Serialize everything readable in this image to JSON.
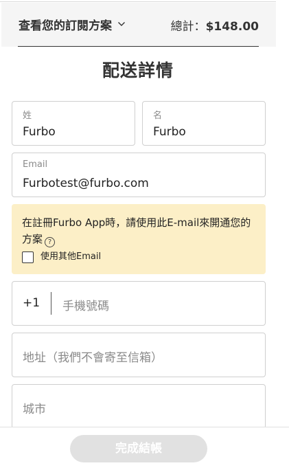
{
  "summary": {
    "toggle_label": "查看您的訂閱方案",
    "total_label": "總計：",
    "total_value": "$148.00"
  },
  "title": "配送詳情",
  "form": {
    "first_name": {
      "label": "姓",
      "value": "Furbo"
    },
    "last_name": {
      "label": "名",
      "value": "Furbo"
    },
    "email": {
      "label": "Email",
      "value": "Furbotest@furbo.com"
    },
    "notice": {
      "text": "在註冊Furbo App時，請使用此E-mail來開通您的方案",
      "help_icon": "question-circle-icon",
      "checkbox_label": "使用其他Email"
    },
    "phone": {
      "prefix": "+1",
      "placeholder": "手機號碼"
    },
    "address": {
      "placeholder": "地址（我們不會寄至信箱）"
    },
    "city": {
      "placeholder": "城市"
    }
  },
  "footer": {
    "submit_label": "完成結帳"
  },
  "colors": {
    "notice_bg": "#fcefc7",
    "summary_bg": "#f5f5f5",
    "button_disabled_bg": "#e1e1e1"
  }
}
